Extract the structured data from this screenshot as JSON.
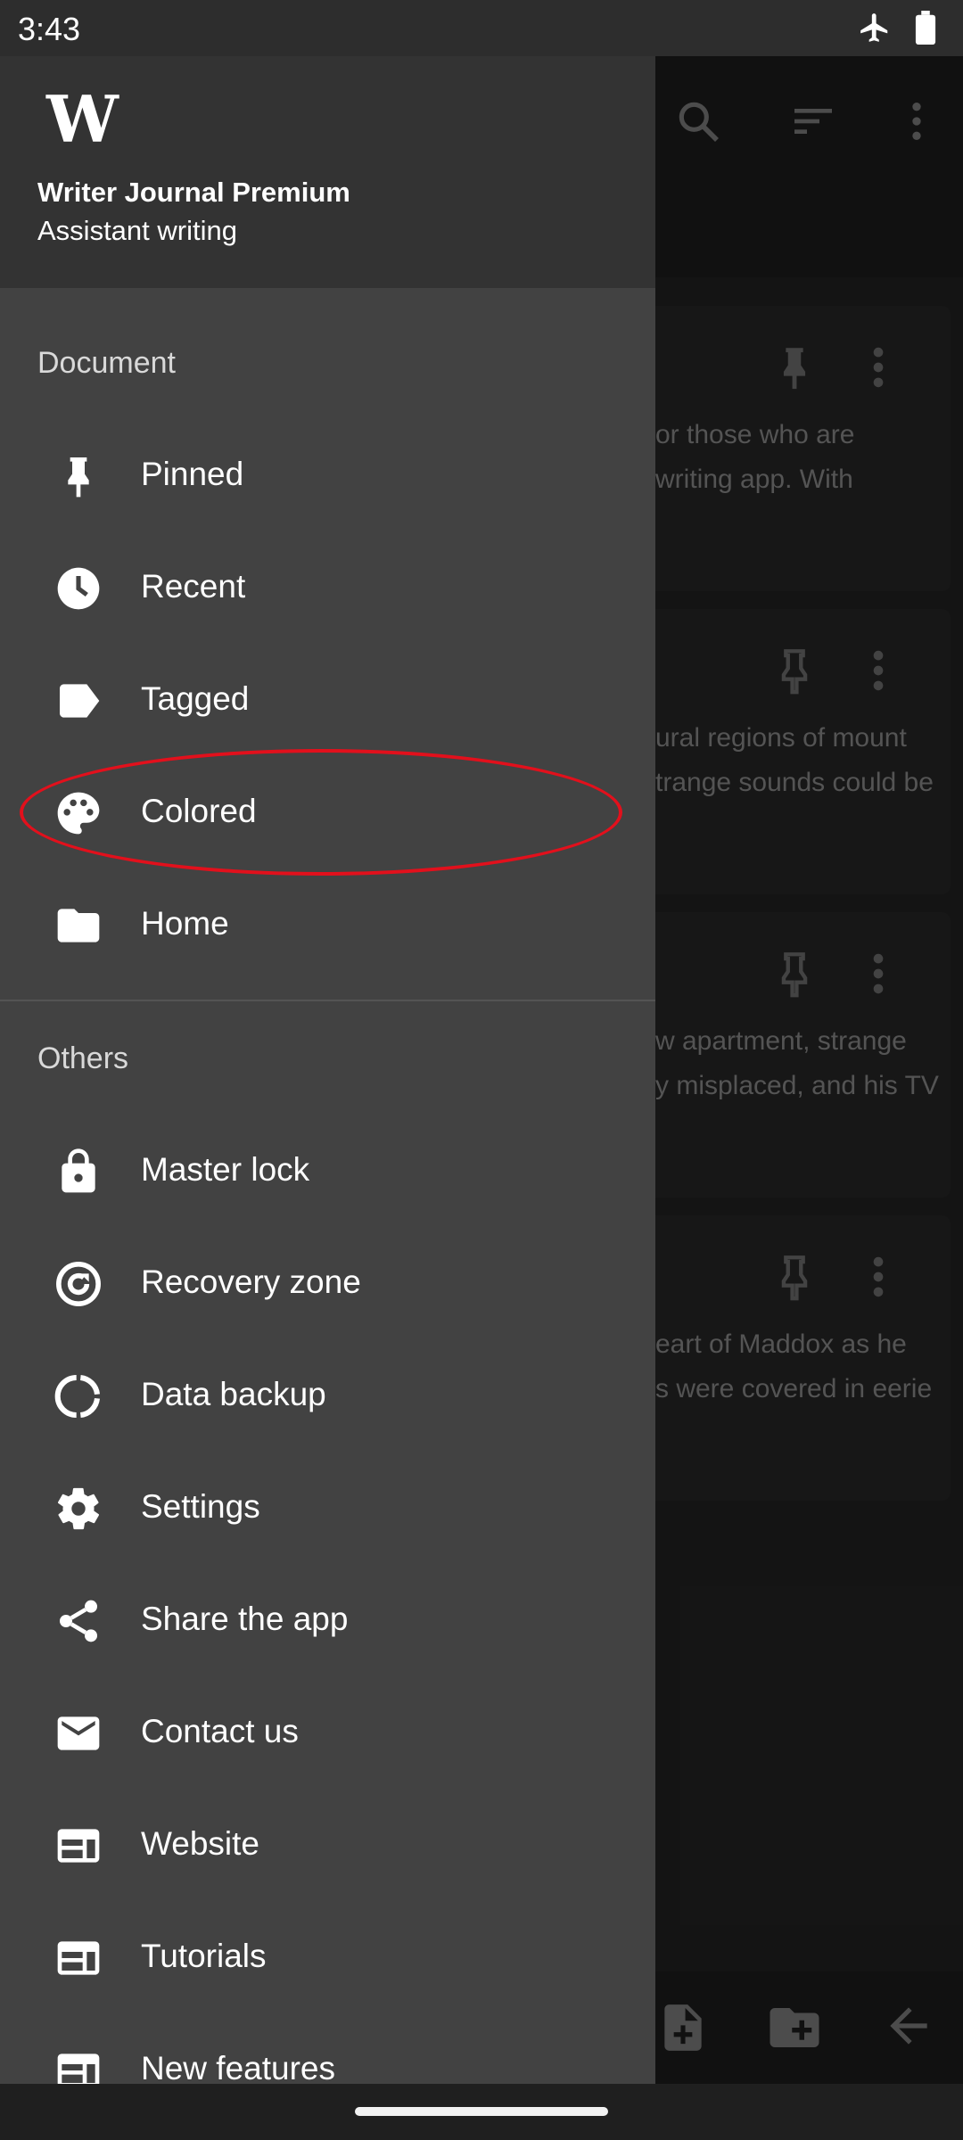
{
  "status_bar": {
    "time": "3:43"
  },
  "drawer": {
    "app_title": "Writer Journal Premium",
    "app_subtitle": "Assistant writing",
    "logo_text": "W",
    "sections": {
      "document": {
        "title": "Document",
        "items": [
          {
            "label": "Pinned",
            "icon": "pin-icon"
          },
          {
            "label": "Recent",
            "icon": "clock-icon"
          },
          {
            "label": "Tagged",
            "icon": "tag-icon"
          },
          {
            "label": "Colored",
            "icon": "palette-icon"
          },
          {
            "label": "Home",
            "icon": "folder-icon"
          }
        ]
      },
      "others": {
        "title": "Others",
        "items": [
          {
            "label": "Master lock",
            "icon": "lock-icon"
          },
          {
            "label": "Recovery zone",
            "icon": "recovery-icon"
          },
          {
            "label": "Data backup",
            "icon": "backup-icon"
          },
          {
            "label": "Settings",
            "icon": "gear-icon"
          },
          {
            "label": "Share the app",
            "icon": "share-icon"
          },
          {
            "label": "Contact us",
            "icon": "mail-icon"
          },
          {
            "label": "Website",
            "icon": "web-icon"
          },
          {
            "label": "Tutorials",
            "icon": "tutorial-icon"
          },
          {
            "label": "New features",
            "icon": "features-icon"
          }
        ]
      }
    }
  },
  "background_notes": [
    {
      "line1": "or those who are",
      "line2": "writing app. With"
    },
    {
      "line1": "ural regions of mount",
      "line2": "trange sounds could be"
    },
    {
      "line1": "w apartment, strange",
      "line2": "y misplaced, and his TV"
    },
    {
      "line1": "eart of Maddox as he",
      "line2": "s were covered in eerie"
    }
  ],
  "colors": {
    "drawer_bg": "#424242",
    "header_bg": "#333333",
    "highlight": "#e2101c"
  }
}
